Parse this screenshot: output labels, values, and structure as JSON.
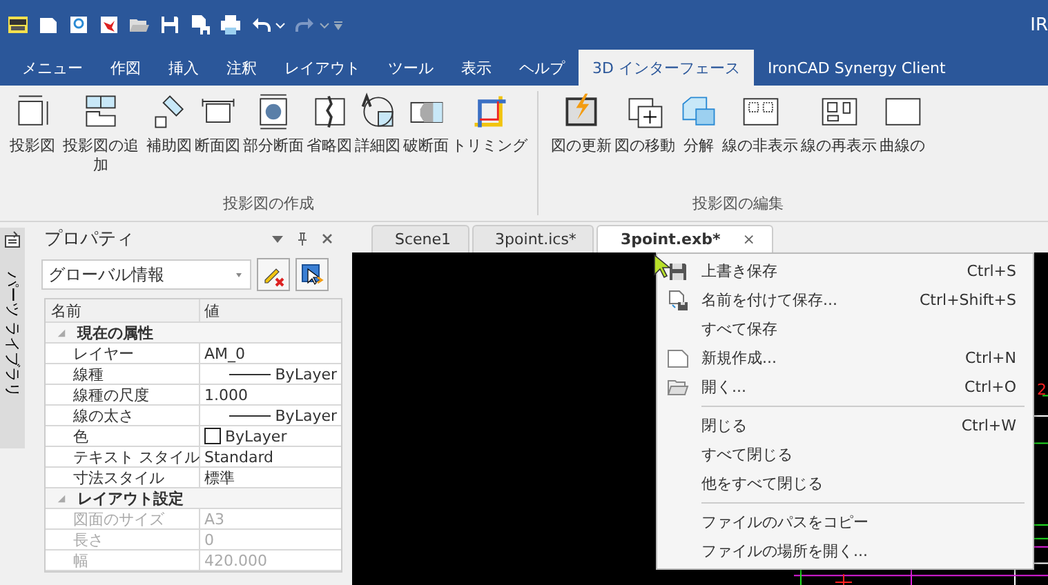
{
  "title_bar": {
    "title": "IR"
  },
  "ribbon_tabs": [
    {
      "label": "メニュー",
      "selected": false
    },
    {
      "label": "作図",
      "selected": false
    },
    {
      "label": "挿入",
      "selected": false
    },
    {
      "label": "注釈",
      "selected": false
    },
    {
      "label": "レイアウト",
      "selected": false
    },
    {
      "label": "ツール",
      "selected": false
    },
    {
      "label": "表示",
      "selected": false
    },
    {
      "label": "ヘルプ",
      "selected": false
    },
    {
      "label": "3D インターフェース",
      "selected": true
    },
    {
      "label": "IronCAD Synergy Client",
      "selected": false
    }
  ],
  "ribbon_groups": [
    {
      "title": "投影図の作成",
      "buttons": [
        {
          "kind": "view",
          "label": "投影図"
        },
        {
          "kind": "addview",
          "label": "投影図の追加"
        },
        {
          "kind": "aux",
          "label": "補助図"
        },
        {
          "kind": "section",
          "label": "断面図"
        },
        {
          "kind": "partial",
          "label": "部分断面"
        },
        {
          "kind": "break",
          "label": "省略図"
        },
        {
          "kind": "detail",
          "label": "詳細図"
        },
        {
          "kind": "broken",
          "label": "破断面"
        },
        {
          "kind": "trim",
          "label": "トリミング"
        }
      ]
    },
    {
      "title": "投影図の編集",
      "buttons": [
        {
          "kind": "update",
          "label": "図の更新"
        },
        {
          "kind": "move",
          "label": "図の移動"
        },
        {
          "kind": "explode",
          "label": "分解"
        },
        {
          "kind": "hide",
          "label": "線の非表示"
        },
        {
          "kind": "show",
          "label": "線の再表示"
        },
        {
          "kind": "curve",
          "label": "曲線の"
        }
      ]
    }
  ],
  "side_tab": {
    "label": "パーツ ライブラリ"
  },
  "properties": {
    "title": "プロパティ",
    "combo": {
      "value": "グローバル情報"
    },
    "columns": [
      "名前",
      "値"
    ],
    "rows": [
      {
        "kind": "category",
        "name": "現在の属性",
        "expanded": true
      },
      {
        "kind": "text",
        "name": "レイヤー",
        "value": "AM_0",
        "disabled": false
      },
      {
        "kind": "line",
        "name": "線種",
        "value": "ByLayer",
        "disabled": false
      },
      {
        "kind": "text",
        "name": "線種の尺度",
        "value": "1.000",
        "disabled": false
      },
      {
        "kind": "line",
        "name": "線の太さ",
        "value": "ByLayer",
        "disabled": false
      },
      {
        "kind": "swatch",
        "name": "色",
        "value": "ByLayer",
        "disabled": false
      },
      {
        "kind": "text",
        "name": "テキスト スタイル",
        "value": "Standard",
        "disabled": false
      },
      {
        "kind": "text",
        "name": "寸法スタイル",
        "value": "標準",
        "disabled": false
      },
      {
        "kind": "category",
        "name": "レイアウト設定",
        "expanded": true
      },
      {
        "kind": "text",
        "name": "図面のサイズ",
        "value": "A3",
        "disabled": true
      },
      {
        "kind": "text",
        "name": "長さ",
        "value": "0",
        "disabled": true
      },
      {
        "kind": "text",
        "name": "幅",
        "value": "420.000",
        "disabled": true
      }
    ]
  },
  "doc_tabs": [
    {
      "label": "Scene1",
      "selected": false
    },
    {
      "label": "3point.ics*",
      "selected": false
    },
    {
      "label": "3point.exb*",
      "selected": true,
      "close": "×"
    }
  ],
  "canvas": {
    "label": "2"
  },
  "context_menu": [
    {
      "kind": "save",
      "label": "上書き保存",
      "shortcut": "Ctrl+S"
    },
    {
      "kind": "saveas",
      "label": "名前を付けて保存...",
      "shortcut": "Ctrl+Shift+S"
    },
    {
      "kind": "plain",
      "label": "すべて保存"
    },
    {
      "kind": "new",
      "label": "新規作成...",
      "shortcut": "Ctrl+N"
    },
    {
      "kind": "open",
      "label": "開く...",
      "shortcut": "Ctrl+O"
    },
    {
      "kind": "separator"
    },
    {
      "kind": "plain",
      "label": "閉じる",
      "shortcut": "Ctrl+W"
    },
    {
      "kind": "plain",
      "label": "すべて閉じる"
    },
    {
      "kind": "plain",
      "label": "他をすべて閉じる"
    },
    {
      "kind": "separator"
    },
    {
      "kind": "plain",
      "label": "ファイルのパスをコピー"
    },
    {
      "kind": "plain",
      "label": "ファイルの場所を開く..."
    }
  ]
}
